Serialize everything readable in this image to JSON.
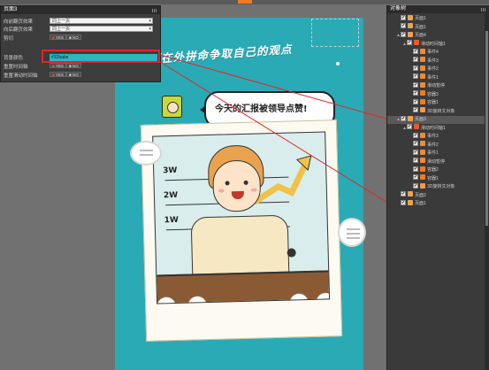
{
  "property_panel": {
    "title": "页面3",
    "rows": [
      {
        "label": "向前翻页效果",
        "value": "同上一页"
      },
      {
        "label": "向后翻页效果",
        "value": "同上一页"
      },
      {
        "label": "剪切",
        "yes": "YES",
        "no": "NO"
      },
      {
        "label": "背景颜色",
        "value": "#32babe"
      },
      {
        "label": "重置时间轴",
        "yes": "YES",
        "no": "NO"
      },
      {
        "label": "重置滑动时间轴",
        "yes": "YES",
        "no": "NO"
      }
    ]
  },
  "preview": {
    "headline": "我们在外拼命争取自己的观点",
    "speech": "今天的汇报被领导点赞!",
    "chart_labels": [
      "3W",
      "2W",
      "1W"
    ]
  },
  "object_panel": {
    "title": "对象树",
    "items": [
      {
        "label": "页面1",
        "icon": "page-icon",
        "indent": 1,
        "exp": "",
        "checked": true
      },
      {
        "label": "页面1",
        "icon": "page-icon",
        "indent": 1,
        "exp": "",
        "checked": true
      },
      {
        "label": "页面4",
        "icon": "page-icon",
        "indent": 1,
        "exp": "▲",
        "checked": true
      },
      {
        "label": "滑动时间轴1",
        "icon": "timeline-icon",
        "indent": 2,
        "exp": "▲",
        "checked": true
      },
      {
        "label": "事件4",
        "icon": "event-icon",
        "indent": 3,
        "exp": "",
        "checked": true
      },
      {
        "label": "事件3",
        "icon": "event-icon",
        "indent": 3,
        "exp": "",
        "checked": true
      },
      {
        "label": "事件2",
        "icon": "event-icon",
        "indent": 3,
        "exp": "",
        "checked": true
      },
      {
        "label": "事件1",
        "icon": "event-icon",
        "indent": 3,
        "exp": "",
        "checked": true
      },
      {
        "label": "滑动暂停",
        "icon": "event-icon",
        "indent": 3,
        "exp": "",
        "checked": true
      },
      {
        "label": "容器3",
        "icon": "container-icon",
        "indent": 3,
        "exp": "",
        "checked": true
      },
      {
        "label": "容器1",
        "icon": "container-icon",
        "indent": 3,
        "exp": "",
        "checked": true
      },
      {
        "label": "3D旋转文对象",
        "icon": "object3d-icon",
        "indent": 3,
        "exp": "",
        "checked": true
      },
      {
        "label": "页面3",
        "icon": "page-icon",
        "indent": 1,
        "exp": "▲",
        "checked": true,
        "selected": true
      },
      {
        "label": "滑动时间轴1",
        "icon": "timeline-icon",
        "indent": 2,
        "exp": "▲",
        "checked": true
      },
      {
        "label": "事件3",
        "icon": "event-icon",
        "indent": 3,
        "exp": "",
        "checked": true
      },
      {
        "label": "事件2",
        "icon": "event-icon",
        "indent": 3,
        "exp": "",
        "checked": true
      },
      {
        "label": "事件1",
        "icon": "event-icon",
        "indent": 3,
        "exp": "",
        "checked": true
      },
      {
        "label": "滑动暂停",
        "icon": "event-icon",
        "indent": 3,
        "exp": "",
        "checked": true
      },
      {
        "label": "容器2",
        "icon": "container-icon",
        "indent": 3,
        "exp": "",
        "checked": true
      },
      {
        "label": "容器1",
        "icon": "container-icon",
        "indent": 3,
        "exp": "",
        "checked": true
      },
      {
        "label": "3D旋转文对象",
        "icon": "object3d-icon",
        "indent": 3,
        "exp": "",
        "checked": true
      },
      {
        "label": "页面2",
        "icon": "page-icon",
        "indent": 1,
        "exp": "",
        "checked": true
      },
      {
        "label": "页面1",
        "icon": "page-icon",
        "indent": 1,
        "exp": "",
        "checked": true
      }
    ]
  },
  "colors": {
    "accent": "#f07b22",
    "stage_bg": "#32babe",
    "highlight": "#e0262a"
  }
}
